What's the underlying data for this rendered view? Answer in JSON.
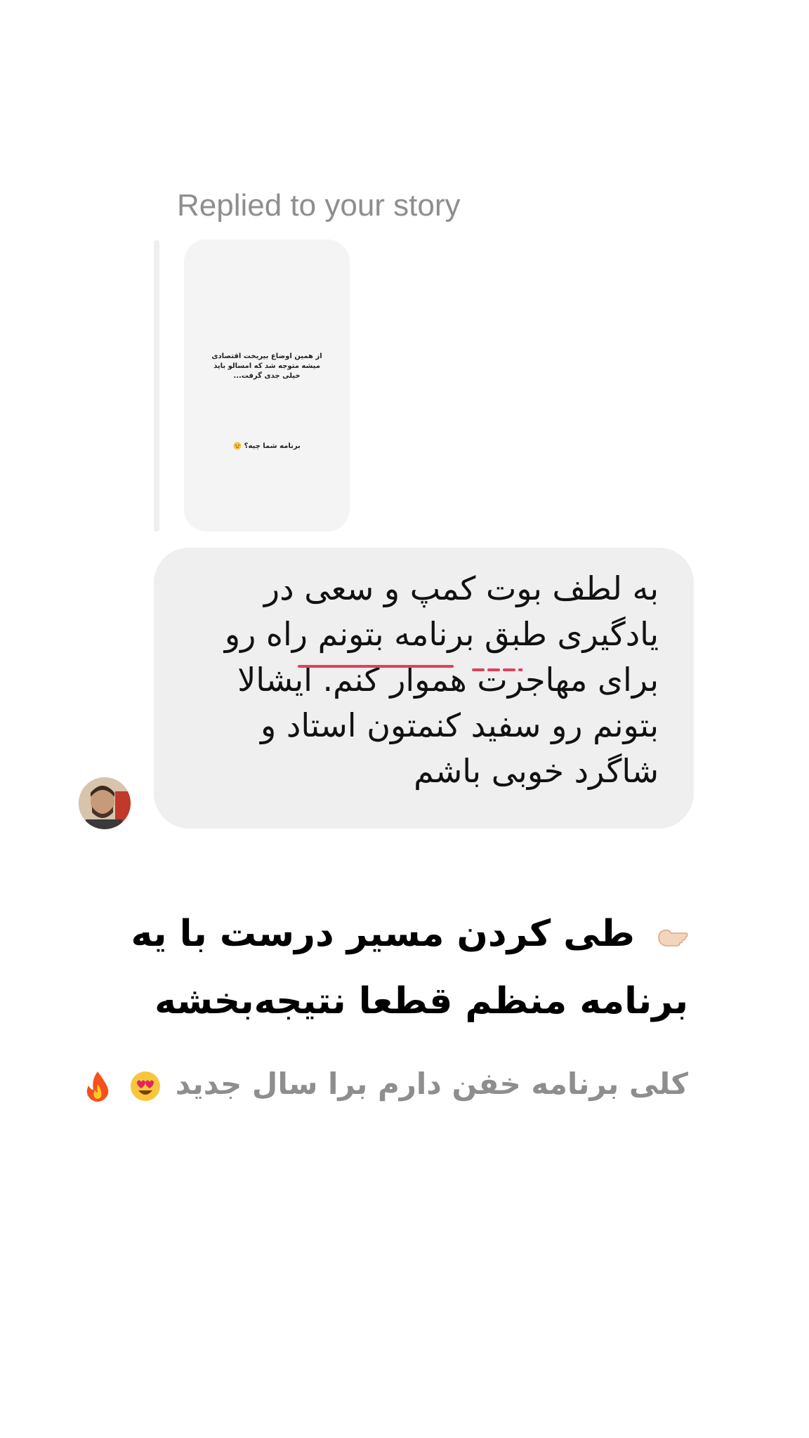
{
  "reply": {
    "label": "Replied to your story"
  },
  "story": {
    "line1": "از همین اوضاع بیریخت اقتصادی\nمیشه متوجه شد که امسالو باید\nخیلی جدی گرفت...",
    "line2": "برنامه شما چیه؟"
  },
  "message": {
    "text": "به لطف بوت کمپ و سعی در یادگیری طبق برنامه بتونم راه رو برای مهاجرت هموار کنم. ایشالا بتونم رو سفید کنمتون استاد و شاگرد خوبی باشم"
  },
  "caption": {
    "headline": "طی کردن مسیر درست با یه برنامه منظم قطعا نتیجه‌بخشه",
    "headline_icon": "pointing-hand-icon",
    "subline": "کلی برنامه خفن دارم برا سال جدید",
    "subline_icons": [
      "heart-eyes-icon",
      "fire-icon"
    ]
  },
  "colors": {
    "bubble": "#efefef",
    "muted_text": "#8e8e8e",
    "spellcheck_underline": "#e0405a"
  }
}
